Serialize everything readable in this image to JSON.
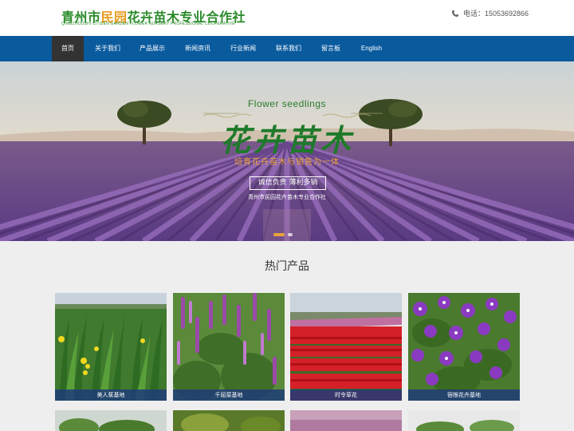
{
  "header": {
    "logo_prefix": "青州市",
    "logo_highlight": "民园",
    "logo_suffix": "花卉苗木专业合作社",
    "logo_subtitle": "QINGZHOUSHI CITIZEN GARDEN FLOWER NURSERY PROFESSIONAL COOPERATIVE",
    "phone_label": "电话：15053692866"
  },
  "nav": {
    "items": [
      {
        "label": "首页",
        "active": true
      },
      {
        "label": "关于我们"
      },
      {
        "label": "产品展示"
      },
      {
        "label": "新闻资讯"
      },
      {
        "label": "行业新闻"
      },
      {
        "label": "联系我们"
      },
      {
        "label": "留言板"
      },
      {
        "label": "English"
      }
    ]
  },
  "banner": {
    "english_title": "Flower seedlings",
    "chinese_title": "花卉苗木",
    "slogan": "培育花卉苗木与销售为一体",
    "box_text": "诚信负责 薄利多销",
    "cooperative": "青州市民园花卉苗木专业合作社"
  },
  "products": {
    "title": "热门产品",
    "items": [
      {
        "caption": "美人蕉基地"
      },
      {
        "caption": "千屈菜基地"
      },
      {
        "caption": "时令草花"
      },
      {
        "caption": "宿根花卉基地"
      }
    ]
  },
  "colors": {
    "nav_bg": "#0a5a9e",
    "nav_active": "#333333",
    "logo_green": "#2a8a2a",
    "logo_orange": "#e89a1b"
  }
}
